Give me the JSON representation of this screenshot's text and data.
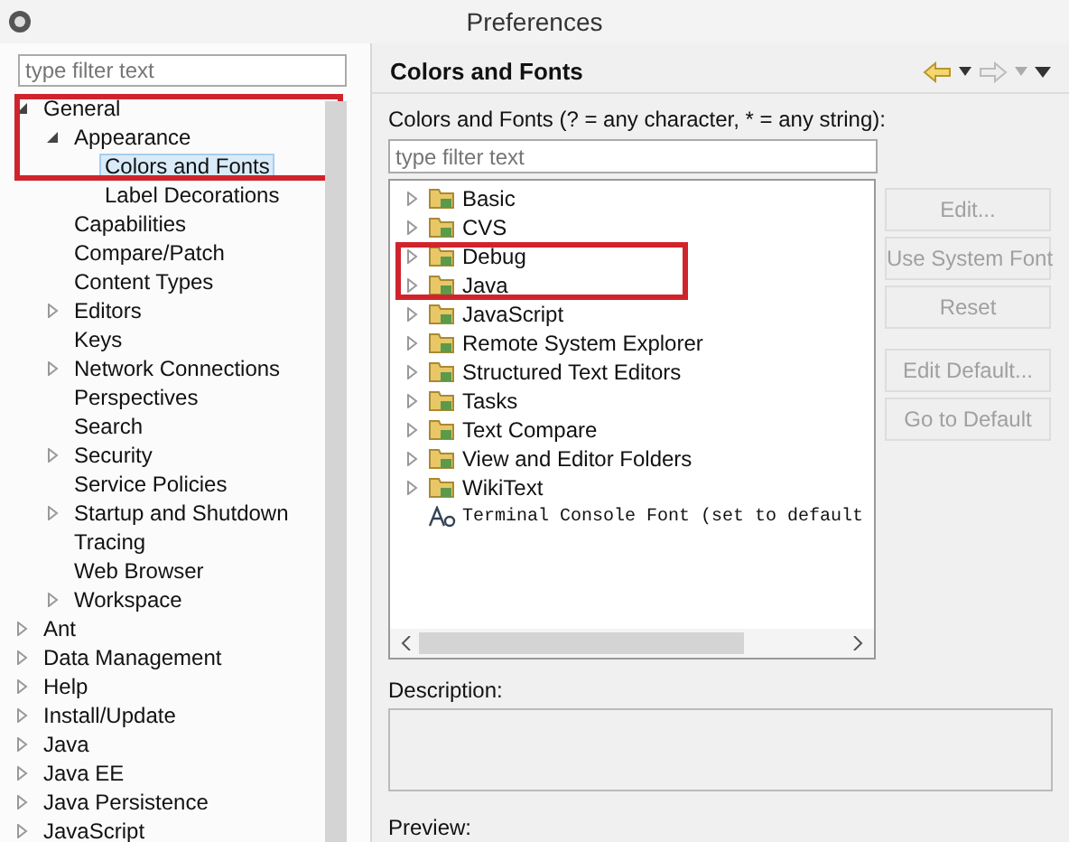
{
  "window": {
    "title": "Preferences"
  },
  "left_filter": {
    "placeholder": "type filter text"
  },
  "preferences_tree": [
    {
      "label": "General",
      "expanded": true,
      "annotated": true,
      "selected": false,
      "children": [
        {
          "label": "Appearance",
          "expanded": true,
          "annotated": true,
          "selected": false,
          "children": [
            {
              "label": "Colors and Fonts",
              "annotated": true,
              "selected": true
            },
            {
              "label": "Label Decorations",
              "annotated": false,
              "selected": false
            }
          ]
        },
        {
          "label": "Capabilities",
          "annotated": false,
          "selected": false
        },
        {
          "label": "Compare/Patch",
          "annotated": false,
          "selected": false
        },
        {
          "label": "Content Types",
          "annotated": false,
          "selected": false
        },
        {
          "label": "Editors",
          "expanded": false,
          "annotated": false,
          "selected": false
        },
        {
          "label": "Keys",
          "annotated": false,
          "selected": false
        },
        {
          "label": "Network Connections",
          "expanded": false,
          "annotated": false,
          "selected": false
        },
        {
          "label": "Perspectives",
          "annotated": false,
          "selected": false
        },
        {
          "label": "Search",
          "annotated": false,
          "selected": false
        },
        {
          "label": "Security",
          "expanded": false,
          "annotated": false,
          "selected": false
        },
        {
          "label": "Service Policies",
          "annotated": false,
          "selected": false
        },
        {
          "label": "Startup and Shutdown",
          "expanded": false,
          "annotated": false,
          "selected": false
        },
        {
          "label": "Tracing",
          "annotated": false,
          "selected": false
        },
        {
          "label": "Web Browser",
          "annotated": false,
          "selected": false
        },
        {
          "label": "Workspace",
          "expanded": false,
          "annotated": false,
          "selected": false
        }
      ]
    },
    {
      "label": "Ant",
      "expanded": false,
      "annotated": false,
      "selected": false
    },
    {
      "label": "Data Management",
      "expanded": false,
      "annotated": false,
      "selected": false
    },
    {
      "label": "Help",
      "expanded": false,
      "annotated": false,
      "selected": false
    },
    {
      "label": "Install/Update",
      "expanded": false,
      "annotated": false,
      "selected": false
    },
    {
      "label": "Java",
      "expanded": false,
      "annotated": false,
      "selected": false
    },
    {
      "label": "Java EE",
      "expanded": false,
      "annotated": false,
      "selected": false
    },
    {
      "label": "Java Persistence",
      "expanded": false,
      "annotated": false,
      "selected": false
    },
    {
      "label": "JavaScript",
      "expanded": false,
      "annotated": false,
      "selected": false
    }
  ],
  "page": {
    "title": "Colors and Fonts",
    "filter_label": "Colors and Fonts (? = any character, * = any string):",
    "filter": {
      "placeholder": "type filter text"
    },
    "items": [
      {
        "label": "Basic",
        "kind": "category",
        "annotated": false
      },
      {
        "label": "CVS",
        "kind": "category",
        "annotated": false
      },
      {
        "label": "Debug",
        "kind": "category",
        "annotated": true
      },
      {
        "label": "Java",
        "kind": "category",
        "annotated": true
      },
      {
        "label": "JavaScript",
        "kind": "category",
        "annotated": false
      },
      {
        "label": "Remote System Explorer",
        "kind": "category",
        "annotated": false
      },
      {
        "label": "Structured Text Editors",
        "kind": "category",
        "annotated": false
      },
      {
        "label": "Tasks",
        "kind": "category",
        "annotated": false
      },
      {
        "label": "Text Compare",
        "kind": "category",
        "annotated": false
      },
      {
        "label": "View and Editor Folders",
        "kind": "category",
        "annotated": false
      },
      {
        "label": "WikiText",
        "kind": "category",
        "annotated": false
      },
      {
        "label": "Terminal Console Font (set to default",
        "kind": "font",
        "annotated": false
      }
    ],
    "buttons": [
      {
        "label": "Edit...",
        "disabled": true
      },
      {
        "label": "Use System Font",
        "disabled": true
      },
      {
        "label": "Reset",
        "disabled": true
      }
    ],
    "default_buttons": [
      {
        "label": "Edit Default...",
        "disabled": true
      },
      {
        "label": "Go to Default",
        "disabled": true
      }
    ],
    "description_label": "Description:",
    "preview_label": "Preview:"
  }
}
